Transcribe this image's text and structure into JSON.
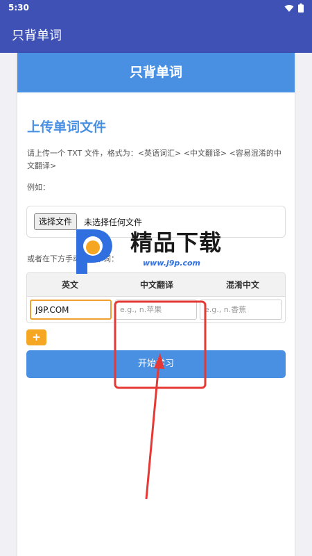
{
  "status": {
    "time": "5:30"
  },
  "app": {
    "title": "只背单词"
  },
  "card": {
    "header": "只背单词",
    "section_title": "上传单词文件",
    "description": "请上传一个 TXT 文件，格式为：<英语词汇> <中文翻译> <容易混淆的中文翻译>",
    "example_label": "例如：",
    "file": {
      "button": "选择文件",
      "status": "未选择任何文件"
    },
    "manual_label": "或者在下方手动输入单词：",
    "table": {
      "headers": [
        "英文",
        "中文翻译",
        "混淆中文"
      ],
      "row": {
        "english_value": "J9P.COM",
        "chinese_placeholder": "e.g., n.苹果",
        "confusing_placeholder": "e.g., n.香蕉"
      }
    },
    "add_button": "+",
    "start_button": "开始学习"
  },
  "watermark": {
    "brand": "精品下载",
    "url": "www.j9p.com"
  },
  "colors": {
    "primary": "#3f51b5",
    "accent_blue": "#4a90e2",
    "orange": "#f5a623",
    "annotation_red": "#e53935"
  }
}
